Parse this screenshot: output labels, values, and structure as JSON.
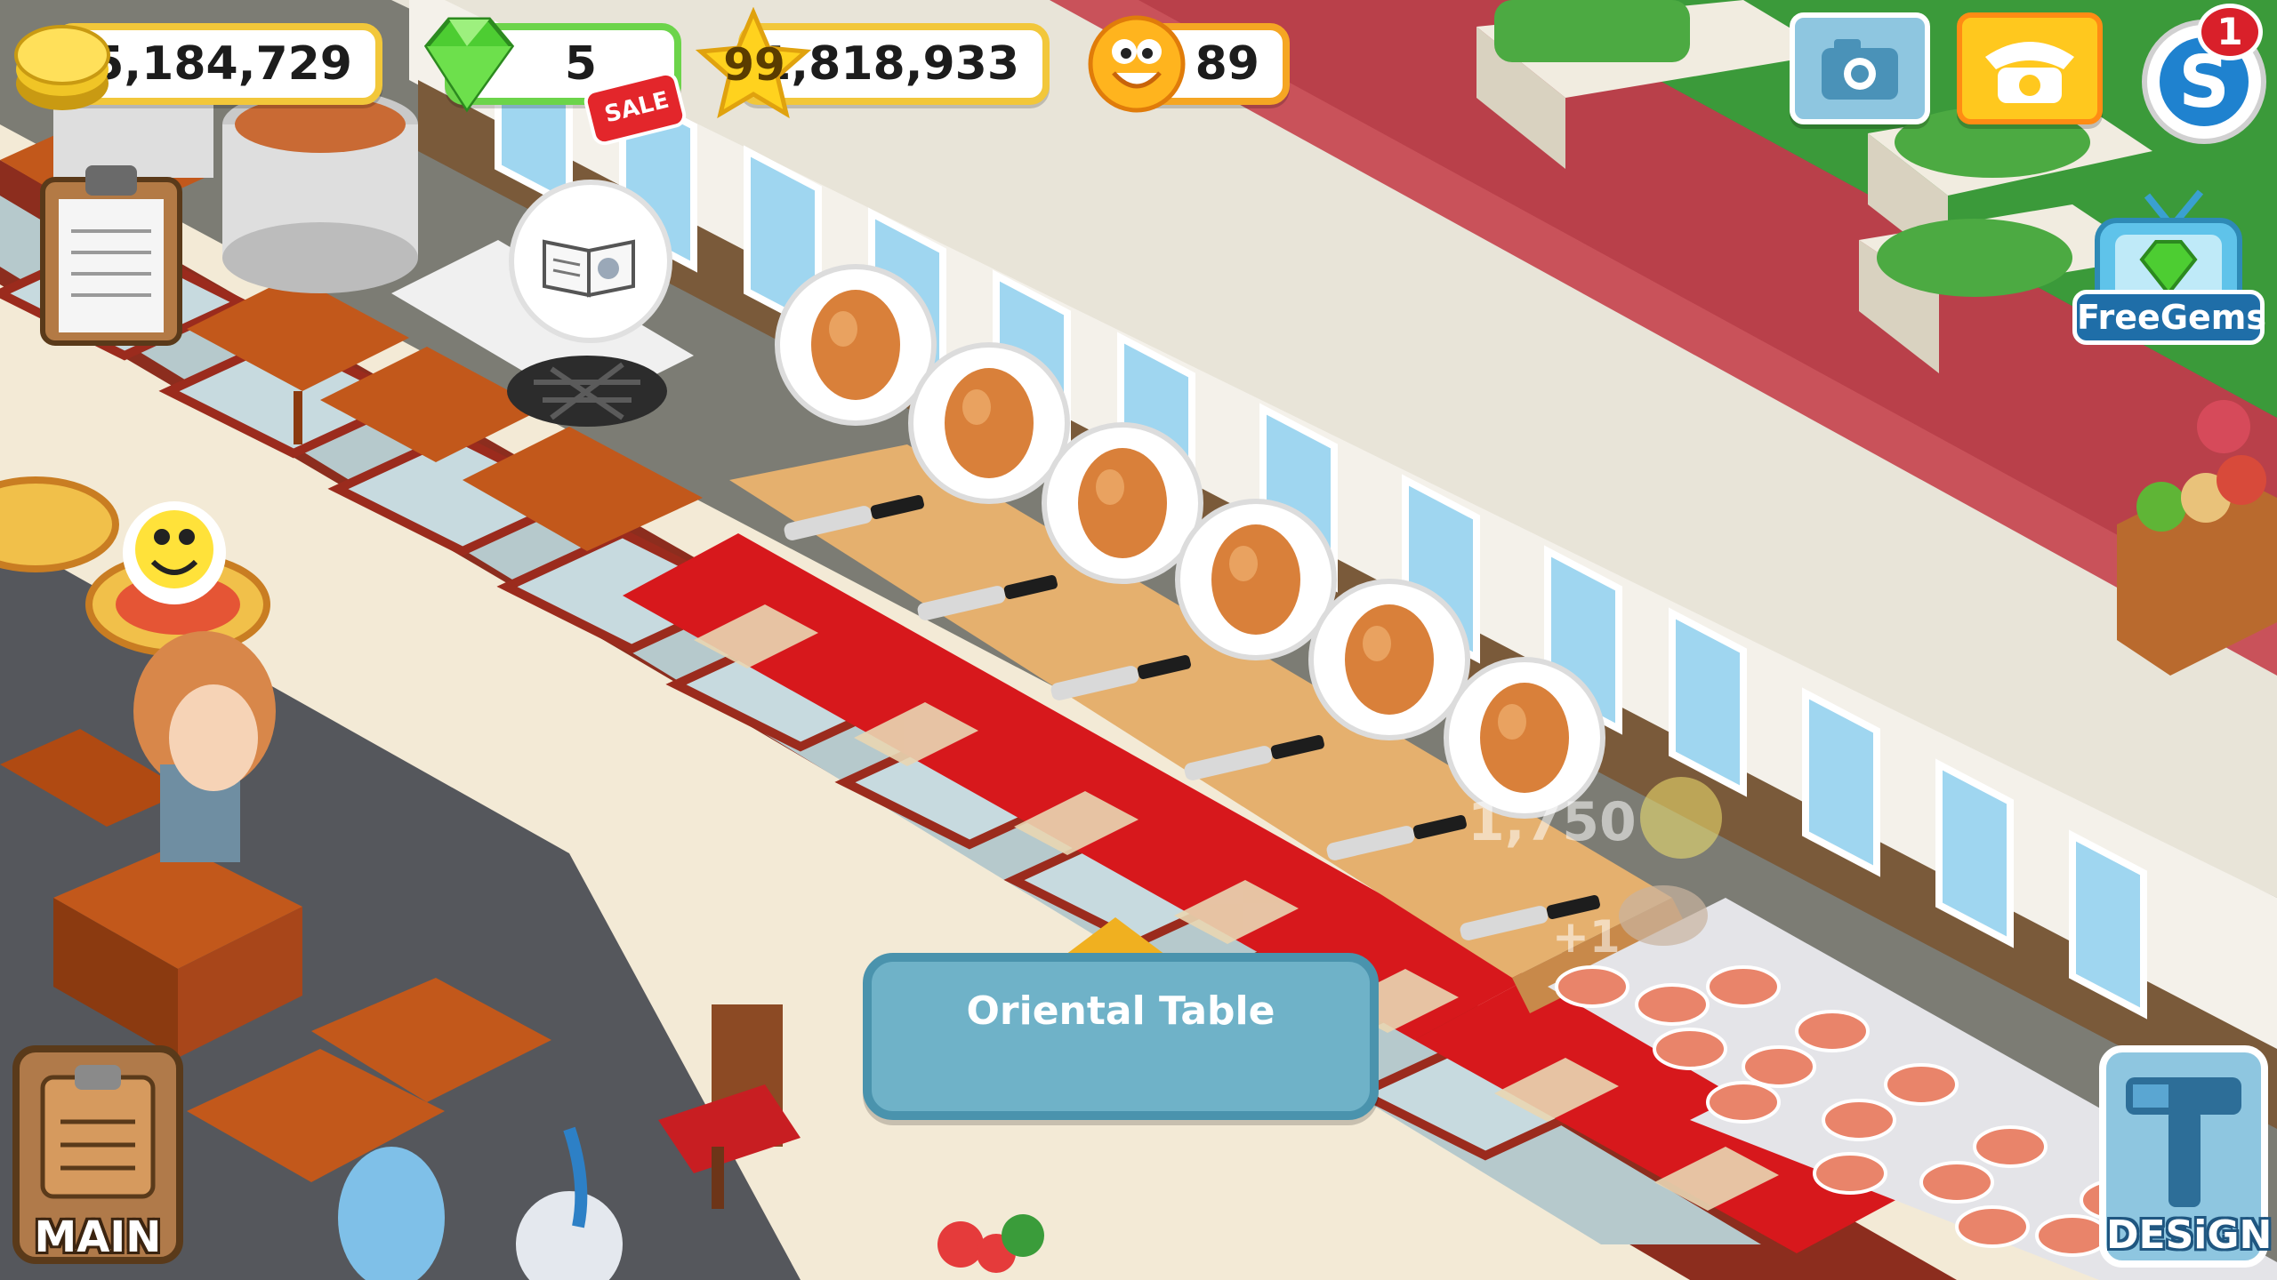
{
  "hud": {
    "coins": "15,184,729",
    "gems": "5",
    "sale_label": "SALE",
    "level": "99",
    "experience": "1,818,933",
    "happiness": "89"
  },
  "buttons": {
    "notification_count": "1",
    "free_gems_label": "FreeGems",
    "main_label": "MAIN",
    "design_label": "DESiGN"
  },
  "tooltip": {
    "title": "Oriental Table"
  },
  "floating": {
    "coin_gain": "1,750",
    "xp_gain": "+1"
  },
  "colors": {
    "coin": "#f2c73a",
    "gem": "#5bd64a",
    "tooltip": "#6fb2c8",
    "design_button": "#8ec6e0",
    "main_button": "#b07a4a",
    "camera_button": "#8ec6e0",
    "phone_button": "#ffc81e"
  },
  "icons": [
    "coin-icon",
    "gem-icon",
    "star-icon",
    "smiley-icon",
    "camera-icon",
    "phone-icon",
    "social-icon",
    "tv-gem-icon",
    "clipboard-icon",
    "hammer-icon",
    "recipe-book-icon"
  ]
}
